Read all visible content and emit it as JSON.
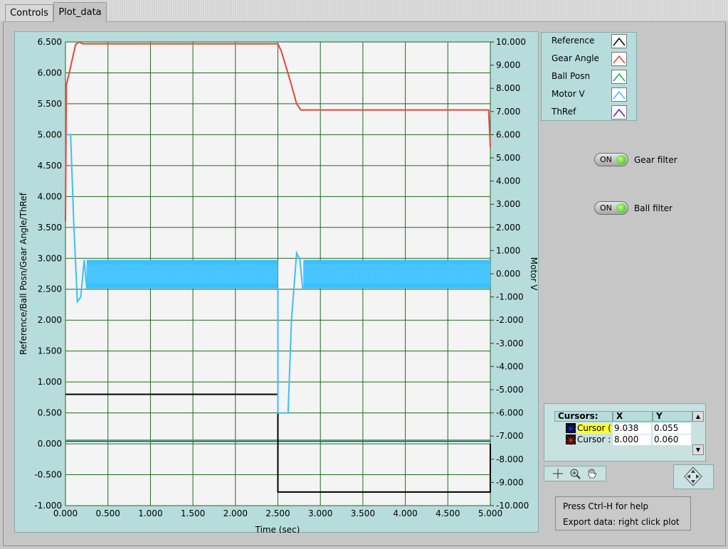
{
  "tabs": [
    {
      "label": "Controls",
      "active": false
    },
    {
      "label": "Plot_data",
      "active": true
    }
  ],
  "legend": [
    {
      "label": "Reference",
      "color": "#000000"
    },
    {
      "label": "Gear Angle",
      "color": "#e8443a"
    },
    {
      "label": "Ball Posn",
      "color": "#14b04a"
    },
    {
      "label": "Motor V",
      "color": "#38c0ff"
    },
    {
      "label": "ThRef",
      "color": "#5a1fd0"
    }
  ],
  "toggles": [
    {
      "state": "ON",
      "label": "Gear filter"
    },
    {
      "state": "ON",
      "label": "Ball filter"
    }
  ],
  "cursors": {
    "title": "Cursors:",
    "col_x": "X",
    "col_y": "Y",
    "rows": [
      {
        "name": "Cursor (",
        "x": "9.038",
        "y": "0.055",
        "color": "#1e38d0",
        "highlight": true
      },
      {
        "name": "Cursor :",
        "x": "8.000",
        "y": "0.060",
        "color": "#e03030",
        "highlight": false
      }
    ]
  },
  "help": {
    "line1": "Press Ctrl-H for help",
    "line2": "Export data: right click plot"
  },
  "chart_data": {
    "type": "line",
    "xlabel": "Time (sec)",
    "ylabel": "Reference/Ball Posn/Gear Angle/ThRef",
    "y2label": "Motor V",
    "xlim": [
      0,
      5
    ],
    "ylim": [
      -1,
      6.5
    ],
    "y2lim": [
      -10,
      10
    ],
    "x_ticks": [
      "0.000",
      "0.500",
      "1.000",
      "1.500",
      "2.000",
      "2.500",
      "3.000",
      "3.500",
      "4.000",
      "4.500",
      "5.000"
    ],
    "y_ticks": [
      "6.500",
      "6.000",
      "5.500",
      "5.000",
      "4.500",
      "4.000",
      "3.500",
      "3.000",
      "2.500",
      "2.000",
      "1.500",
      "1.000",
      "0.500",
      "0.000",
      "-0.500",
      "-1.000"
    ],
    "y2_ticks": [
      "10.000",
      "9.000",
      "8.000",
      "7.000",
      "6.000",
      "5.000",
      "4.000",
      "3.000",
      "2.000",
      "1.000",
      "0.000",
      "-1.000",
      "-2.000",
      "-3.000",
      "-4.000",
      "-5.000",
      "-6.000",
      "-7.000",
      "-8.000",
      "-9.000",
      "-10.000"
    ],
    "grid": true,
    "series": [
      {
        "name": "Reference",
        "axis": "left",
        "color": "#000000",
        "points": [
          [
            0,
            0.8
          ],
          [
            2.5,
            0.8
          ],
          [
            2.5,
            -0.78
          ],
          [
            5,
            -0.78
          ],
          [
            5,
            0
          ]
        ]
      },
      {
        "name": "Gear Angle",
        "axis": "left",
        "color": "#e8443a",
        "points": [
          [
            0,
            3.6
          ],
          [
            0.01,
            5.8
          ],
          [
            0.06,
            6.1
          ],
          [
            0.12,
            6.46
          ],
          [
            0.16,
            6.5
          ],
          [
            0.2,
            6.47
          ],
          [
            2.5,
            6.47
          ],
          [
            2.54,
            6.35
          ],
          [
            2.65,
            5.85
          ],
          [
            2.72,
            5.5
          ],
          [
            2.77,
            5.4
          ],
          [
            2.85,
            5.4
          ],
          [
            4.98,
            5.4
          ],
          [
            5,
            4.8
          ]
        ]
      },
      {
        "name": "Ball Posn",
        "axis": "left",
        "color": "#14b04a",
        "points": [
          [
            0,
            0.06
          ],
          [
            5,
            0.06
          ]
        ]
      },
      {
        "name": "ThRef",
        "axis": "left",
        "color": "#5a1fd0",
        "points": [
          [
            0,
            0.04
          ],
          [
            5,
            0.04
          ]
        ]
      },
      {
        "name": "Motor V",
        "axis": "right",
        "color": "#38c0ff",
        "points": [
          [
            0,
            6.0
          ],
          [
            0.06,
            6.0
          ],
          [
            0.1,
            2.0
          ],
          [
            0.14,
            -1.2
          ],
          [
            0.18,
            -1.0
          ],
          [
            0.22,
            0.6
          ],
          [
            0.25,
            -0.6
          ],
          [
            2.5,
            -0.6
          ],
          [
            2.5,
            -6.0
          ],
          [
            2.62,
            -6.0
          ],
          [
            2.66,
            -2.0
          ],
          [
            2.72,
            0.9
          ],
          [
            2.76,
            0.6
          ],
          [
            2.79,
            -0.6
          ],
          [
            5,
            -0.6
          ]
        ],
        "oscillation": {
          "from": [
            [
              0.25,
              2.5
            ],
            [
              2.8,
              5.0
            ]
          ],
          "range": [
            -0.6,
            0.6
          ]
        }
      }
    ]
  }
}
